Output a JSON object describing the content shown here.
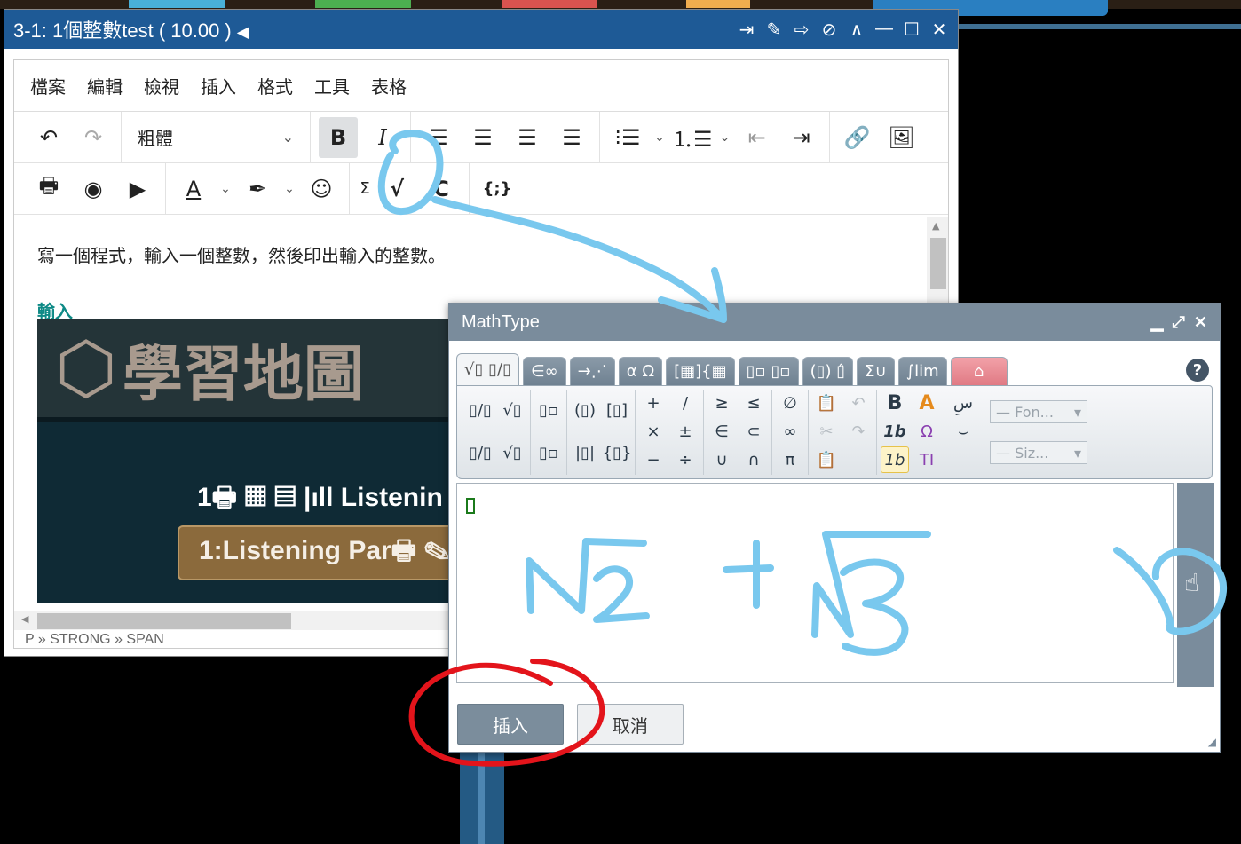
{
  "editor": {
    "title": "3-1: 1個整數test ( 10.00 )",
    "menu": [
      "檔案",
      "編輯",
      "檢視",
      "插入",
      "格式",
      "工具",
      "表格"
    ],
    "font_select": "粗體",
    "italic_label": "I",
    "bold_label": "B",
    "sigma_label": "Σ",
    "code_label": "{;}",
    "content_paragraph": "寫一個程式，輸入一個整數，然後印出輸入的整數。",
    "content_heading": "輸入",
    "image": {
      "logo_text": "學習地圖",
      "listening_text": "1🖶 ▦ ▤ |ıll Listenin",
      "button_text": "1:Listening Par🖶 ✎"
    },
    "statusbar": "P » STRONG » SPAN"
  },
  "mathtype": {
    "title": "MathType",
    "tabs": [
      "√▯ ▯/▯",
      "∈∞",
      "→⋰",
      "α Ω",
      "[▦]{▦",
      "▯▫ ▯▫",
      "(▯) ▯̂",
      "Σ∪",
      "∫lim",
      "⌂"
    ],
    "palette": {
      "fractions": [
        "▯/▯",
        "▯/▯",
        "√▯",
        "√▯"
      ],
      "scripts": [
        "▯▫",
        "▯▫"
      ],
      "brackets": [
        "(▯)",
        "|▯|",
        "[▯]",
        "{▯}"
      ],
      "operators": [
        "+",
        "×",
        "−",
        "/",
        "±",
        "÷"
      ],
      "relations": [
        "≥",
        "∈",
        "∪",
        "≤",
        "⊂",
        "∩"
      ],
      "symbols": [
        "∅",
        "∞",
        "π"
      ],
      "edit": [
        "📋",
        "✂",
        "📋",
        "↶",
        "↷"
      ],
      "format": [
        "B",
        "1b",
        "1b",
        "A",
        "Ω",
        "TI"
      ],
      "rtl": [
        "سِ",
        "⌣"
      ]
    },
    "font_combo": "— Fon...",
    "size_combo": "— Siz...",
    "insert_label": "插入",
    "cancel_label": "取消"
  }
}
